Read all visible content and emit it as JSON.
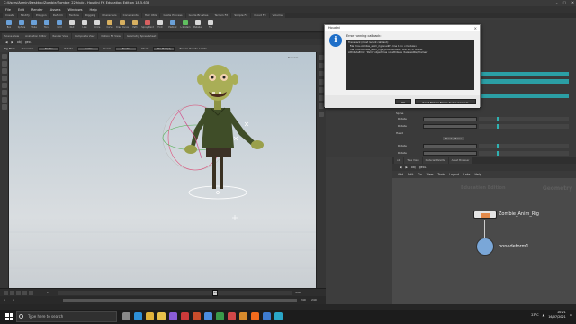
{
  "window": {
    "title": "C:/Users/Admin/Desktop/Zombie/Zombie_22.hiplc - Houdini FX Education Edition 18.5.633"
  },
  "menubar": [
    "File",
    "Edit",
    "Render",
    "Assets",
    "Windows",
    "Help"
  ],
  "shelf_tabs": [
    "Create",
    "Modify",
    "Polygon",
    "Deform",
    "Texture",
    "Rigging",
    "Characters",
    "Constraints",
    "Hair Utils",
    "Guide Process",
    "Guide Brushes",
    "Terrain FX",
    "Simple FX",
    "Cloud FX",
    "Volume"
  ],
  "shelf_tools": [
    {
      "label": "Box",
      "color": "#6aa0d8"
    },
    {
      "label": "Sphere",
      "color": "#6aa0d8"
    },
    {
      "label": "Tube",
      "color": "#6aa0d8"
    },
    {
      "label": "Torus",
      "color": "#6aa0d8"
    },
    {
      "label": "Grid",
      "color": "#6aa0d8"
    },
    {
      "label": "Null",
      "color": "#d8d8d8"
    },
    {
      "label": "Line",
      "color": "#d8d8d8"
    },
    {
      "label": "Circle",
      "color": "#d8d8d8"
    },
    {
      "label": "Curve",
      "color": "#d8b060"
    },
    {
      "label": "Draw Curve",
      "color": "#d8b060"
    },
    {
      "label": "Path",
      "color": "#d8b060"
    },
    {
      "label": "Spray Paint",
      "color": "#d86060"
    },
    {
      "label": "Font",
      "color": "#d8d8d8"
    },
    {
      "label": "Platonic",
      "color": "#6aa0d8"
    },
    {
      "label": "L-System",
      "color": "#60c060"
    },
    {
      "label": "Metaball",
      "color": "#d8d8d8"
    },
    {
      "label": "File",
      "color": "#d8d8d8"
    }
  ],
  "pane_tabs": [
    "Scene View",
    "Animation Editor",
    "Render View",
    "Composite View",
    "Motion FX View",
    "Geometry Spreadsheet"
  ],
  "path": {
    "root": "obj",
    "node": "geo1"
  },
  "viewport_toolbar": {
    "mode": "Rig Pose",
    "fields": [
      {
        "label": "Translate",
        "value": "Enable"
      },
      {
        "label": "Rotate",
        "value": "Enable"
      },
      {
        "label": "Scale",
        "value": "Enable"
      },
      {
        "label": "Mode",
        "value": "Pre Multiply"
      }
    ],
    "option": "Freeze Rotate Limits"
  },
  "viewport": {
    "camera_label": "No cam"
  },
  "timeline": {
    "current_frame": "1",
    "cursor_frame": "72",
    "end_frame": "240"
  },
  "range_bar": {
    "start": "1",
    "start2": "1",
    "end": "240",
    "end2": "240"
  },
  "params": {
    "rows": [
      {
        "label": "Rotate"
      },
      {
        "label": "Rotate"
      },
      {
        "label": "Rotate"
      },
      {
        "label": "Rotate"
      }
    ],
    "section_spine": "Spine",
    "section_head": "Head",
    "button_label": "Neck / Bone"
  },
  "dialog": {
    "title": "Houdini",
    "close": "×",
    "message": "Error running callback:",
    "traceback": "Traceback (most recent call last):\n  File \"hou.zombie_anim_rig/onedit\", line 1, in <module>\n  File \"hou.zombie_anim_rig.PythonModule\", line 12, in onedit\nAttributeError: 'Parm' object has no attribute 'deleteAllKeyframes'",
    "ok_label": "OK",
    "send_label": "Send Failure Errors to the Console"
  },
  "net_tabs": [
    "obj",
    "Tree View",
    "Material Palette",
    "Asset Browser"
  ],
  "net_path": {
    "root": "obj",
    "node": "geo1"
  },
  "net_menu": [
    "Add",
    "Edit",
    "Go",
    "View",
    "Tools",
    "Layout",
    "Labs",
    "Help"
  ],
  "network": {
    "watermark": "Education Edition",
    "context": "Geometry",
    "nodes": [
      {
        "name": "Zombie_Anim_Rig",
        "color": "#e38a4b"
      },
      {
        "name": "bonedeform1",
        "color": "#7aa7d8"
      }
    ]
  },
  "taskbar": {
    "search_placeholder": "Type here to search",
    "apps": [
      {
        "name": "task-view",
        "color": "#888"
      },
      {
        "name": "edge",
        "color": "#2d8fd6"
      },
      {
        "name": "chrome",
        "color": "#e0b23a"
      },
      {
        "name": "explorer",
        "color": "#e7c04a"
      },
      {
        "name": "vs",
        "color": "#8a5cd6"
      },
      {
        "name": "app1",
        "color": "#cc3a3a"
      },
      {
        "name": "app2",
        "color": "#c84d2b"
      },
      {
        "name": "app3",
        "color": "#4b8de0"
      },
      {
        "name": "app4",
        "color": "#3a9a4a"
      },
      {
        "name": "app5",
        "color": "#d04848"
      },
      {
        "name": "app6",
        "color": "#d68a2c"
      },
      {
        "name": "houdini",
        "color": "#f06a1c"
      },
      {
        "name": "app7",
        "color": "#3e7bd0"
      },
      {
        "name": "app8",
        "color": "#2aa6c8"
      }
    ],
    "temperature": "23°C",
    "time": "10:21",
    "date": "16/07/2021"
  }
}
